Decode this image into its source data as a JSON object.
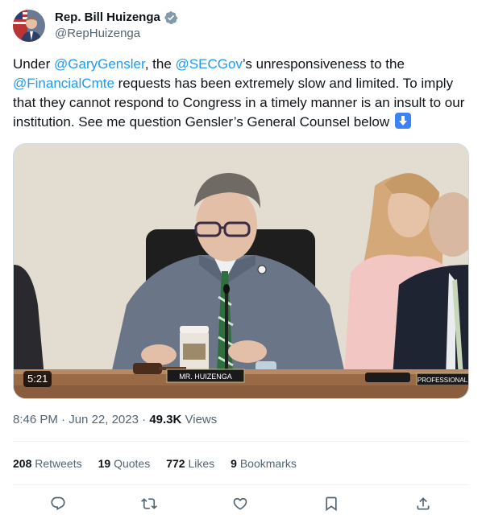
{
  "author": {
    "display_name": "Rep. Bill Huizenga",
    "handle": "@RepHuizenga",
    "verified_icon": "verified-badge-icon"
  },
  "tweet": {
    "text_parts": {
      "p1": "Under ",
      "m1": "@GaryGensler",
      "p2": ", the ",
      "m2": "@SECGov",
      "p3": "’s unresponsiveness to the ",
      "m3": "@FinancialCmte",
      "p4": " requests has been extremely slow and limited. To imply that they cannot respond to Congress in a timely manner is an insult to our institution. See me question Gensler’s General Counsel below "
    },
    "emoji": "down-arrow-button-emoji"
  },
  "media": {
    "duration": "5:21",
    "nameplate": "MR. HUIZENGA",
    "nameplate_right": "PROFESSIONAL"
  },
  "meta": {
    "time": "8:46 PM",
    "sep1": " · ",
    "date": "Jun 22, 2023",
    "sep2": " · ",
    "views_count": "49.3K",
    "views_label": " Views"
  },
  "stats": {
    "retweets_count": "208",
    "retweets_label": " Retweets",
    "quotes_count": "19",
    "quotes_label": " Quotes",
    "likes_count": "772",
    "likes_label": " Likes",
    "bookmarks_count": "9",
    "bookmarks_label": " Bookmarks"
  },
  "actions": [
    "reply-icon",
    "retweet-icon",
    "like-icon",
    "bookmark-icon",
    "share-icon"
  ],
  "colors": {
    "link": "#1d9bf0",
    "secondary_text": "#536471",
    "primary_text": "#0f1419",
    "divider": "#eff3f4"
  }
}
